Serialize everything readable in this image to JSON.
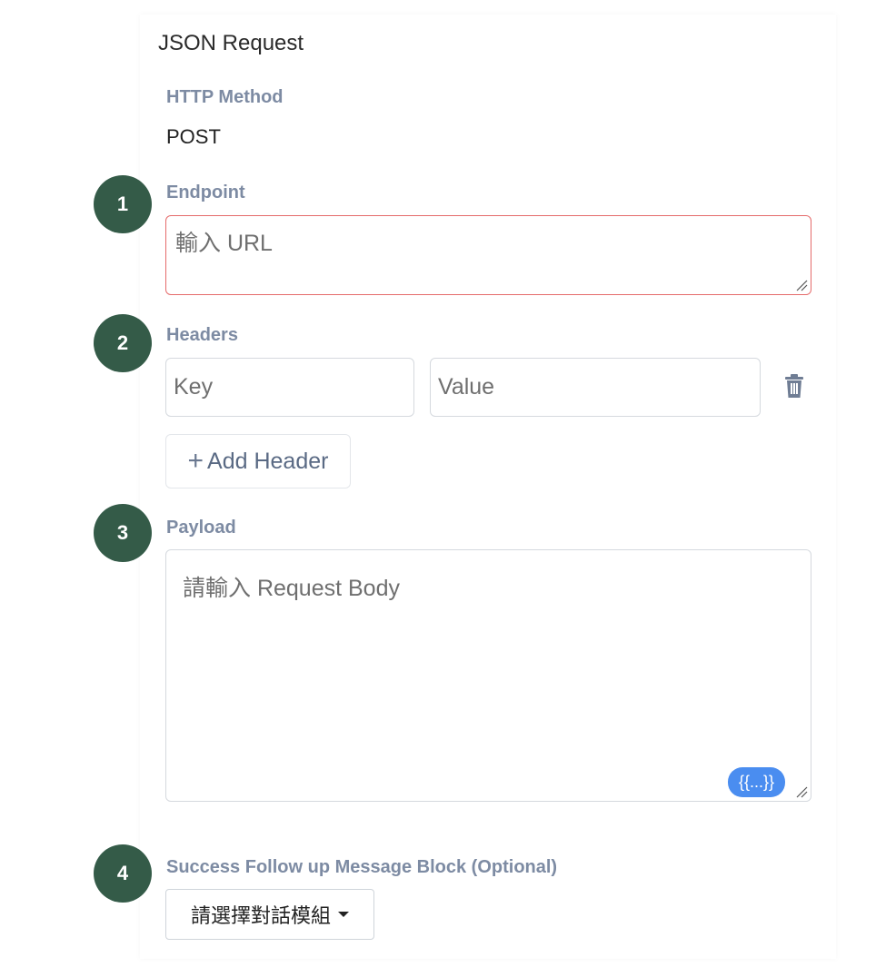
{
  "panel": {
    "title": "JSON Request"
  },
  "http_method": {
    "label": "HTTP Method",
    "value": "POST"
  },
  "steps": [
    "1",
    "2",
    "3",
    "4"
  ],
  "endpoint": {
    "label": "Endpoint",
    "placeholder": "輸入 URL"
  },
  "headers": {
    "label": "Headers",
    "key_placeholder": "Key",
    "value_placeholder": "Value",
    "add_label": "Add Header",
    "add_symbol": "+"
  },
  "payload": {
    "label": "Payload",
    "placeholder": "請輸入 Request Body",
    "variable_chip": "{{...}}"
  },
  "success_block": {
    "label": "Success Follow up Message Block (Optional)",
    "select_value": "請選擇對話模組"
  },
  "colors": {
    "step_badge": "#345b48",
    "label": "#7d8ba3",
    "error_border": "#e56b6b",
    "chip": "#4a8df0"
  }
}
